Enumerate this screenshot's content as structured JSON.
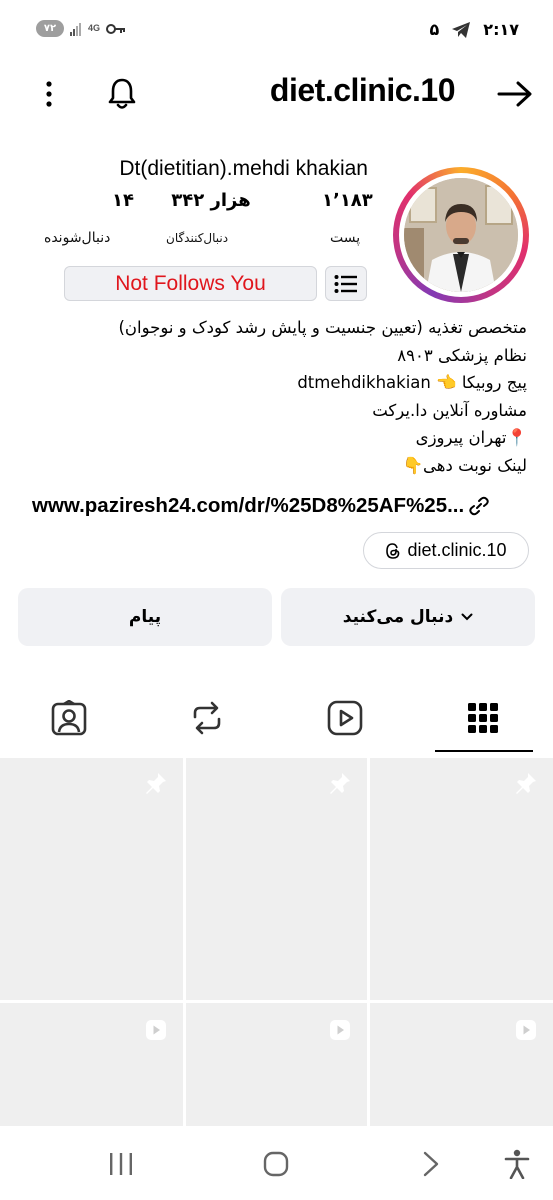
{
  "status_bar": {
    "battery": "۷۲",
    "network": "4G",
    "time": "۲:۱۷",
    "notification_count": "۵"
  },
  "header": {
    "username": "diet.clinic.10"
  },
  "profile": {
    "display_name": "Dt(dietitian).mehdi khakian",
    "stats": {
      "posts_value": "۱٬۱۸۳",
      "posts_label": "پست",
      "followers_value": "۳۴۲ هزار",
      "followers_label": "دنبال‌کنندگان",
      "following_value": "۱۴",
      "following_label": "دنبال‌شونده"
    },
    "not_follows_label": "Not Follows You",
    "bio_lines": [
      "متخصص تغذیه (تعیین جنسیت و پایش رشد کودک و نوجوان)",
      "نظام پزشکی ۸۹۰۳",
      "پیج روبیکا 👈 dtmehdikhakian",
      "مشاوره آنلاین دا.یرکت",
      "📍تهران پیروزی",
      "لینک نوبت دهی👇"
    ],
    "link": "www.paziresh24.com/dr/%25D8%25AF%25...",
    "threads_handle": "diet.clinic.10"
  },
  "actions": {
    "follow_label": "دنبال می‌کنید",
    "message_label": "پیام"
  },
  "tabs": [
    "tagged-tab",
    "reposts-tab",
    "reels-tab",
    "grid-tab"
  ],
  "grid": {
    "row1_icons": [
      "pin-icon",
      "pin-icon",
      "pin-icon"
    ],
    "row2_icons": [
      "reel-icon",
      "reel-icon",
      "reel-icon"
    ]
  }
}
